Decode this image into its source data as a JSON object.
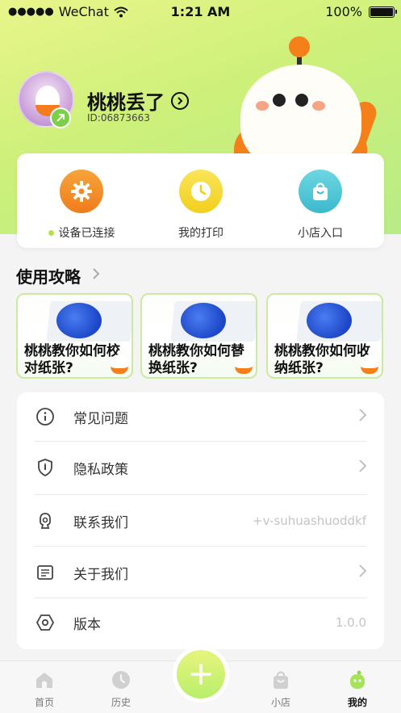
{
  "status_bar": {
    "dots": "●●●●●",
    "carrier": "WeChat",
    "time": "1:21 AM",
    "battery": "100%"
  },
  "profile": {
    "name": "桃桃丢了",
    "id": "ID:06873663"
  },
  "quick_actions": [
    {
      "label": "设备已连接",
      "icon": "gear-icon",
      "color": "#f38a2a"
    },
    {
      "label": "我的打印",
      "icon": "clock-icon",
      "color": "#f6dc2e"
    },
    {
      "label": "小店入口",
      "icon": "shopping-bag-icon",
      "color": "#4fc6d6"
    }
  ],
  "guides": {
    "title": "使用攻略",
    "items": [
      {
        "title": "桃桃教你如何校对纸张?"
      },
      {
        "title": "桃桃教你如何替换纸张?"
      },
      {
        "title": "桃桃教你如何收纳纸张?"
      }
    ]
  },
  "menu": [
    {
      "label": "常见问题",
      "icon": "info-icon",
      "right": ""
    },
    {
      "label": "隐私政策",
      "icon": "shield-icon",
      "right": ""
    },
    {
      "label": "联系我们",
      "icon": "contact-icon",
      "right": "+v-suhuashuoddkf"
    },
    {
      "label": "关于我们",
      "icon": "document-icon",
      "right": ""
    },
    {
      "label": "版本",
      "icon": "hexagon-icon",
      "right": "1.0.0"
    }
  ],
  "tabbar": [
    {
      "label": "首页",
      "icon": "home-icon"
    },
    {
      "label": "历史",
      "icon": "clock-icon"
    },
    {
      "label": "小店",
      "icon": "bag-icon"
    },
    {
      "label": "我的",
      "icon": "mascot-icon"
    }
  ],
  "fab": {
    "icon": "plus-icon"
  },
  "colors": {
    "accent_green": "#b9ee6c",
    "orange": "#f57f18"
  }
}
